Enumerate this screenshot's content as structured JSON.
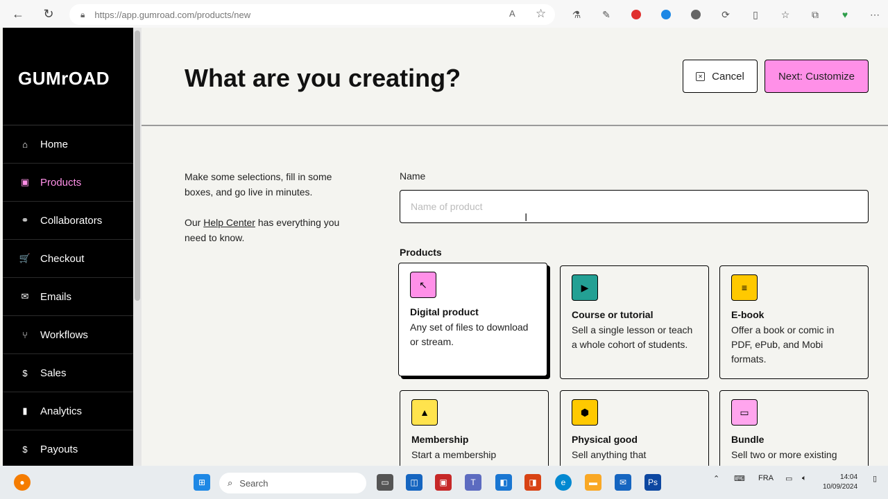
{
  "browser": {
    "url": "https://app.gumroad.com/products/new",
    "icons": [
      "back-icon",
      "refresh-icon",
      "lock-icon",
      "read-aloud-icon",
      "favorite-star-icon"
    ]
  },
  "sidebar": {
    "logo": "GUMrOAD",
    "items": [
      {
        "label": "Home",
        "icon": "⌂"
      },
      {
        "label": "Products",
        "icon": "▣"
      },
      {
        "label": "Collaborators",
        "icon": "⚭"
      },
      {
        "label": "Checkout",
        "icon": "🛒"
      },
      {
        "label": "Emails",
        "icon": "✉"
      },
      {
        "label": "Workflows",
        "icon": "⑂"
      },
      {
        "label": "Sales",
        "icon": "$"
      },
      {
        "label": "Analytics",
        "icon": "▮"
      },
      {
        "label": "Payouts",
        "icon": "$"
      }
    ]
  },
  "header": {
    "title": "What are you creating?",
    "cancel_label": "Cancel",
    "next_label": "Next: Customize"
  },
  "intro": {
    "line1": "Make some selections, fill in some boxes, and go live in minutes.",
    "line2_prefix": "Our ",
    "help_link": "Help Center",
    "line2_suffix": " has everything you need to know."
  },
  "form": {
    "name_label": "Name",
    "name_placeholder": "Name of product",
    "name_value": "",
    "products_label": "Products"
  },
  "cards": [
    {
      "title": "Digital product",
      "desc": "Any set of files to download or stream.",
      "color": "#ff90e8",
      "glyph": "↖",
      "selected": true
    },
    {
      "title": "Course or tutorial",
      "desc": "Sell a single lesson or teach a whole cohort of students.",
      "color": "#23a094",
      "glyph": "▶",
      "selected": false
    },
    {
      "title": "E-book",
      "desc": "Offer a book or comic in PDF, ePub, and Mobi formats.",
      "color": "#ffc900",
      "glyph": "≡",
      "selected": false
    },
    {
      "title": "Membership",
      "desc": "Start a membership",
      "color": "#ffe34d",
      "glyph": "▲",
      "selected": false
    },
    {
      "title": "Physical good",
      "desc": "Sell anything that",
      "color": "#ffc900",
      "glyph": "⬢",
      "selected": false
    },
    {
      "title": "Bundle",
      "desc": "Sell two or more existing",
      "color": "#ffa5ee",
      "glyph": "▭",
      "selected": false
    }
  ],
  "taskbar": {
    "search_placeholder": "Search",
    "language": "FRA",
    "time": "14:04",
    "date": "10/09/2024"
  }
}
